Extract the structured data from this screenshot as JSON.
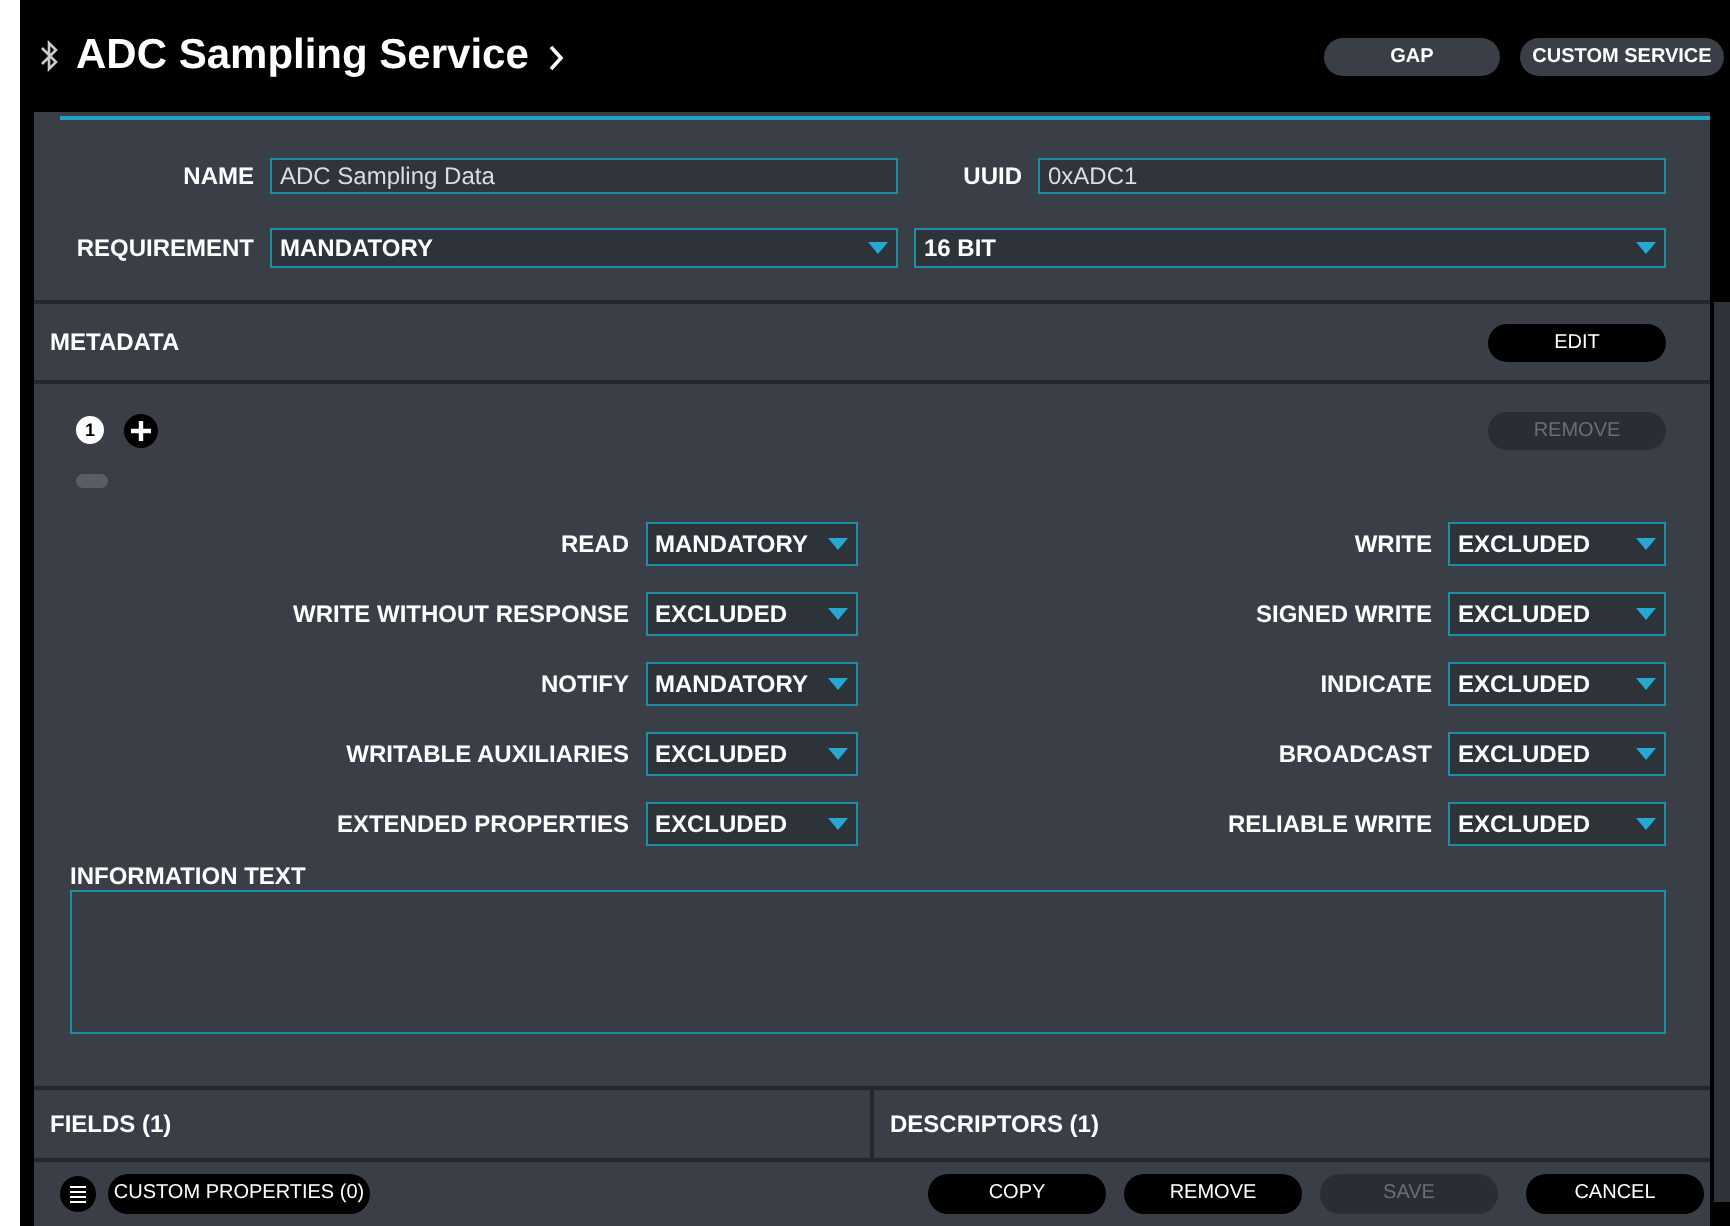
{
  "header": {
    "title": "ADC Sampling Service",
    "buttons": [
      {
        "label": "GAP"
      },
      {
        "label": "CUSTOM SERVICE"
      }
    ]
  },
  "form": {
    "name_label": "NAME",
    "name_value": "ADC Sampling Data",
    "uuid_label": "UUID",
    "uuid_value": "0xADC1",
    "requirement_label": "REQUIREMENT",
    "requirement_value": "MANDATORY",
    "size_value": "16 BIT"
  },
  "metadata": {
    "title": "METADATA",
    "edit_button": "EDIT",
    "index_badge": "1",
    "remove_button": {
      "label": "REMOVE",
      "disabled": true
    },
    "properties": [
      {
        "label": "READ",
        "value": "MANDATORY"
      },
      {
        "label": "WRITE",
        "value": "EXCLUDED"
      },
      {
        "label": "WRITE WITHOUT RESPONSE",
        "value": "EXCLUDED"
      },
      {
        "label": "SIGNED WRITE",
        "value": "EXCLUDED"
      },
      {
        "label": "NOTIFY",
        "value": "MANDATORY"
      },
      {
        "label": "INDICATE",
        "value": "EXCLUDED"
      },
      {
        "label": "WRITABLE AUXILIARIES",
        "value": "EXCLUDED"
      },
      {
        "label": "BROADCAST",
        "value": "EXCLUDED"
      },
      {
        "label": "EXTENDED PROPERTIES",
        "value": "EXCLUDED"
      },
      {
        "label": "RELIABLE WRITE",
        "value": "EXCLUDED"
      }
    ],
    "information_label": "INFORMATION TEXT"
  },
  "sections": [
    {
      "label": "FIELDS (1)"
    },
    {
      "label": "DESCRIPTORS (1)"
    }
  ],
  "footer": {
    "custom_properties": "CUSTOM PROPERTIES (0)",
    "buttons": [
      {
        "label": "COPY",
        "disabled": false
      },
      {
        "label": "REMOVE",
        "disabled": false
      },
      {
        "label": "SAVE",
        "disabled": true
      },
      {
        "label": "CANCEL",
        "disabled": false
      }
    ]
  }
}
